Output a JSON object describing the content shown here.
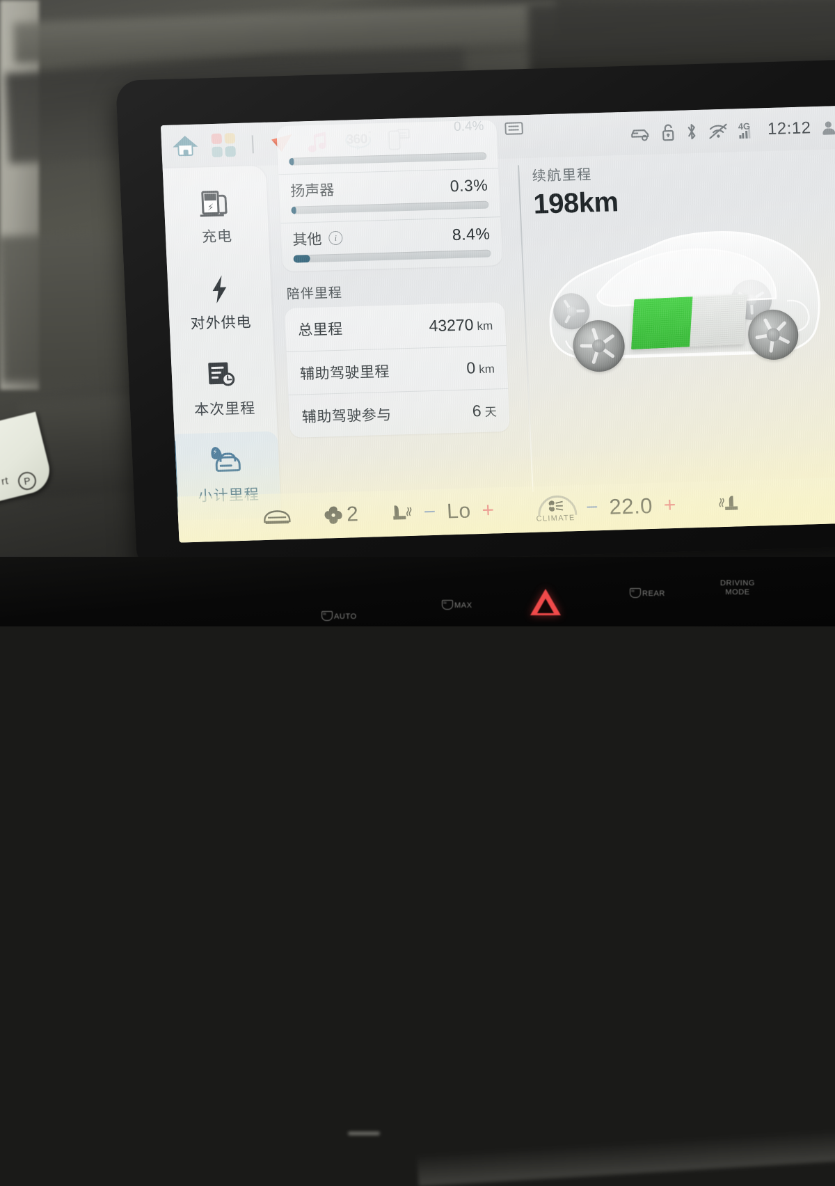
{
  "statusbar": {
    "left_icons": [
      {
        "name": "home-icon",
        "label": "Home"
      },
      {
        "name": "apps-grid-icon",
        "label": "Apps"
      },
      {
        "name": "navigation-arrow-icon",
        "label": "Navigation"
      },
      {
        "name": "music-note-icon",
        "label": "Music"
      },
      {
        "name": "surround-view-360-icon",
        "label": "360"
      },
      {
        "name": "phone-projection-icon",
        "label": "Phone Link"
      }
    ],
    "degree_text": "360",
    "degree_sup": "°",
    "center_icon": "card-list-icon",
    "right_icons": [
      {
        "name": "car-status-icon",
        "label": "Vehicle"
      },
      {
        "name": "unlock-icon",
        "label": "Unlocked"
      },
      {
        "name": "bluetooth-icon",
        "label": "Bluetooth"
      },
      {
        "name": "wifi-off-icon",
        "label": "Wi-Fi off"
      }
    ],
    "network": "4G",
    "clock": "12:12",
    "profile_icon": "user-account-icon",
    "battery_icon": "battery-icon"
  },
  "sidebar": {
    "items": [
      {
        "label": "充电",
        "icon": "charging-station-icon",
        "active": false
      },
      {
        "label": "对外供电",
        "icon": "power-bolt-icon",
        "active": false
      },
      {
        "label": "本次里程",
        "icon": "trip-report-icon",
        "active": false
      },
      {
        "label": "小计里程",
        "icon": "subtotal-mileage-car-icon",
        "active": true
      }
    ]
  },
  "energy": {
    "clipped_top_value": "0.4%",
    "rows": [
      {
        "name": "",
        "value": "",
        "percent": 0.4,
        "clipped": true
      },
      {
        "name": "扬声器",
        "value": "0.3%",
        "percent": 0.3,
        "has_info": false
      },
      {
        "name": "其他",
        "value": "8.4%",
        "percent": 8.4,
        "has_info": true,
        "info_icon": "info-icon"
      }
    ]
  },
  "mileage": {
    "section_title": "陪伴里程",
    "rows": [
      {
        "label": "总里程",
        "value": "43270",
        "unit": "km"
      },
      {
        "label": "辅助驾驶里程",
        "value": "0",
        "unit": "km"
      },
      {
        "label": "辅助驾驶参与",
        "value": "6",
        "unit": "天"
      }
    ]
  },
  "range": {
    "label": "续航里程",
    "value": "198km",
    "battery_percent": 52,
    "battery_fill_color": "#2ec22e"
  },
  "climate": {
    "car_icon": "car-front-icon",
    "fan_icon": "fan-icon",
    "fan_speed": "2",
    "driver_seat_icon": "heated-seat-icon",
    "driver_minus": "−",
    "driver_temp": "Lo",
    "driver_plus": "+",
    "climate_button_label": "CLIMATE",
    "climate_button_icon": "fan-arc-icon",
    "passenger_minus": "−",
    "passenger_temp": "22.0",
    "passenger_plus": "+",
    "passenger_seat_icon": "heated-seat-icon"
  },
  "console": {
    "buttons": [
      {
        "label": "AUTO",
        "icon": "seat-heat-icon"
      },
      {
        "label": "MAX",
        "icon": "front-defrost-icon"
      },
      {
        "label": "",
        "icon": "hazard-triangle-icon"
      },
      {
        "label": "REAR",
        "icon": "rear-defrost-icon"
      },
      {
        "label": "DRIVING",
        "label2": "MODE",
        "icon": "driving-mode-icon"
      }
    ]
  },
  "cluster": {
    "gear_text": "rt",
    "gear_badge": "P"
  },
  "colors": {
    "accent_blue": "#3d7194",
    "bar_fill": "#2b5f77",
    "battery_green": "#2ec22e",
    "minus_blue": "#5b7fc7",
    "plus_red": "#e0536a",
    "hazard_red": "#f04a4a"
  }
}
